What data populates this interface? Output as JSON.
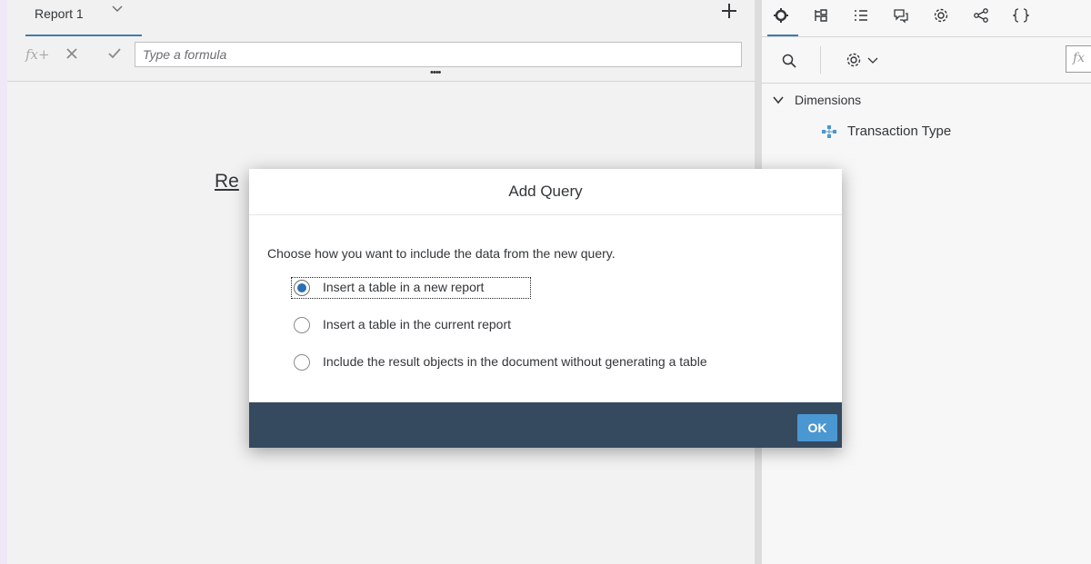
{
  "report_tab": {
    "label": "Report 1"
  },
  "formula_bar": {
    "fx_symbol": "fx+",
    "placeholder": "Type a formula",
    "splitter": "••••"
  },
  "canvas": {
    "report_title": "Re"
  },
  "right_panel": {
    "toolbar_icons": [
      "data-objects-icon",
      "document-structure-icon",
      "list-icon",
      "comment-icon",
      "settings-icon",
      "share-icon",
      "braces-icon"
    ],
    "fx_label": "fx",
    "tree": {
      "root_label": "Dimensions",
      "children": [
        {
          "label": "Transaction Type",
          "icon": "dimension-icon"
        }
      ]
    }
  },
  "dialog": {
    "title": "Add Query",
    "prompt": "Choose how you want to include the data from the new query.",
    "options": [
      {
        "label": "Insert a table in a new report",
        "selected": true
      },
      {
        "label": "Insert a table in the current report",
        "selected": false
      },
      {
        "label": "Include the result objects in the document without generating a table",
        "selected": false
      }
    ],
    "ok_label": "OK"
  },
  "colors": {
    "accent": "#427cac",
    "footer": "#354a5f",
    "ok_button": "#4b97d2",
    "radio_selected": "#2a6fb5"
  }
}
